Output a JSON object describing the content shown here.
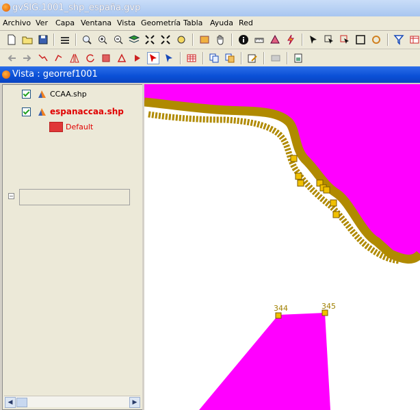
{
  "window": {
    "title": "gvSIG:1001_shp_españa.gvp"
  },
  "menu": [
    "Archivo",
    "Ver",
    "Capa",
    "Ventana",
    "Vista",
    "Geometría",
    "Tabla",
    "Ayuda",
    "Red"
  ],
  "view": {
    "title": "Vista : georref1001"
  },
  "toc": {
    "layers": [
      {
        "name": "CCAA.shp",
        "checked": true,
        "active": false
      },
      {
        "name": "espanaccaa.shp",
        "checked": true,
        "active": true,
        "legend": "Default"
      }
    ]
  },
  "map": {
    "vertex_labels": [
      "344",
      "345"
    ],
    "colors": {
      "fill": "#ff00ff",
      "coast": "#b08a00",
      "vertex": "#f0c000"
    }
  }
}
